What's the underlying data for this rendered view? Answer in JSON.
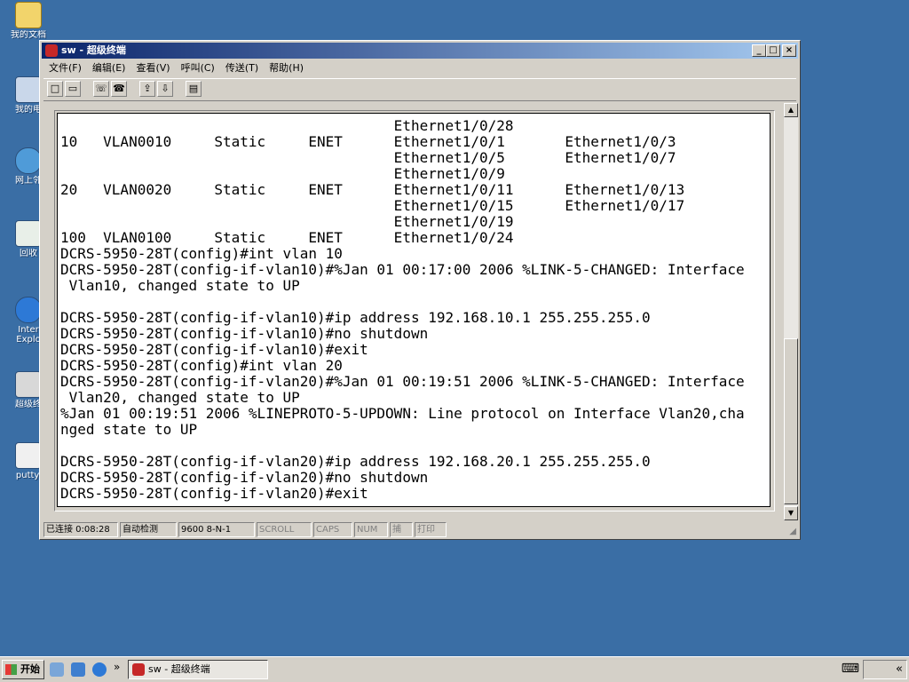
{
  "colors": {
    "desktop": "#3a6ea5",
    "titlebar_start": "#0a246a",
    "titlebar_end": "#a6caf0",
    "face": "#d4d0c8"
  },
  "desktop": {
    "icons": [
      {
        "label": "我的文档",
        "icon": "folder-icon"
      },
      {
        "label": "我的电",
        "icon": "computer-icon"
      },
      {
        "label": "网上邻",
        "icon": "network-icon"
      },
      {
        "label": "回收",
        "icon": "recycle-bin-icon"
      },
      {
        "label": "Inter",
        "label2": "Explo",
        "icon": "ie-icon"
      },
      {
        "label": "超级终",
        "icon": "hyperterminal-shortcut-icon"
      },
      {
        "label": "putty.",
        "icon": "putty-icon"
      }
    ]
  },
  "window": {
    "title": "sw - 超级终端",
    "controls": {
      "minimize": "_",
      "maximize": "□",
      "close": "×"
    },
    "menu": [
      "文件(F)",
      "编辑(E)",
      "查看(V)",
      "呼叫(C)",
      "传送(T)",
      "帮助(H)"
    ],
    "toolbar": [
      {
        "name": "new-icon",
        "glyph": "□"
      },
      {
        "name": "open-icon",
        "glyph": "▭"
      },
      {
        "name": "disconnect-icon",
        "glyph": "☏"
      },
      {
        "name": "call-icon",
        "glyph": "☎"
      },
      {
        "name": "send-icon",
        "glyph": "⇪"
      },
      {
        "name": "receive-icon",
        "glyph": "⇩"
      },
      {
        "name": "properties-icon",
        "glyph": "▤"
      }
    ],
    "terminal_lines": [
      "                                       Ethernet1/0/28",
      "10   VLAN0010     Static     ENET      Ethernet1/0/1       Ethernet1/0/3",
      "                                       Ethernet1/0/5       Ethernet1/0/7",
      "                                       Ethernet1/0/9",
      "20   VLAN0020     Static     ENET      Ethernet1/0/11      Ethernet1/0/13",
      "                                       Ethernet1/0/15      Ethernet1/0/17",
      "                                       Ethernet1/0/19",
      "100  VLAN0100     Static     ENET      Ethernet1/0/24",
      "DCRS-5950-28T(config)#int vlan 10",
      "DCRS-5950-28T(config-if-vlan10)#%Jan 01 00:17:00 2006 %LINK-5-CHANGED: Interface",
      " Vlan10, changed state to UP",
      "",
      "DCRS-5950-28T(config-if-vlan10)#ip address 192.168.10.1 255.255.255.0",
      "DCRS-5950-28T(config-if-vlan10)#no shutdown",
      "DCRS-5950-28T(config-if-vlan10)#exit",
      "DCRS-5950-28T(config)#int vlan 20",
      "DCRS-5950-28T(config-if-vlan20)#%Jan 01 00:19:51 2006 %LINK-5-CHANGED: Interface",
      " Vlan20, changed state to UP",
      "%Jan 01 00:19:51 2006 %LINEPROTO-5-UPDOWN: Line protocol on Interface Vlan20,cha",
      "nged state to UP",
      "",
      "DCRS-5950-28T(config-if-vlan20)#ip address 192.168.20.1 255.255.255.0",
      "DCRS-5950-28T(config-if-vlan20)#no shutdown",
      "DCRS-5950-28T(config-if-vlan20)#exit"
    ],
    "status": {
      "connected": "已连接 0:08:28",
      "detect": "自动检测",
      "settings": "9600 8-N-1",
      "scroll": "SCROLL",
      "caps": "CAPS",
      "num": "NUM",
      "capture": "捕",
      "print": "打印"
    }
  },
  "taskbar": {
    "start_label": "开始",
    "quick_launch_more": "»",
    "task_label": "sw - 超级终端",
    "tray_keyboard": "⌨",
    "tray_arrow": "«"
  }
}
